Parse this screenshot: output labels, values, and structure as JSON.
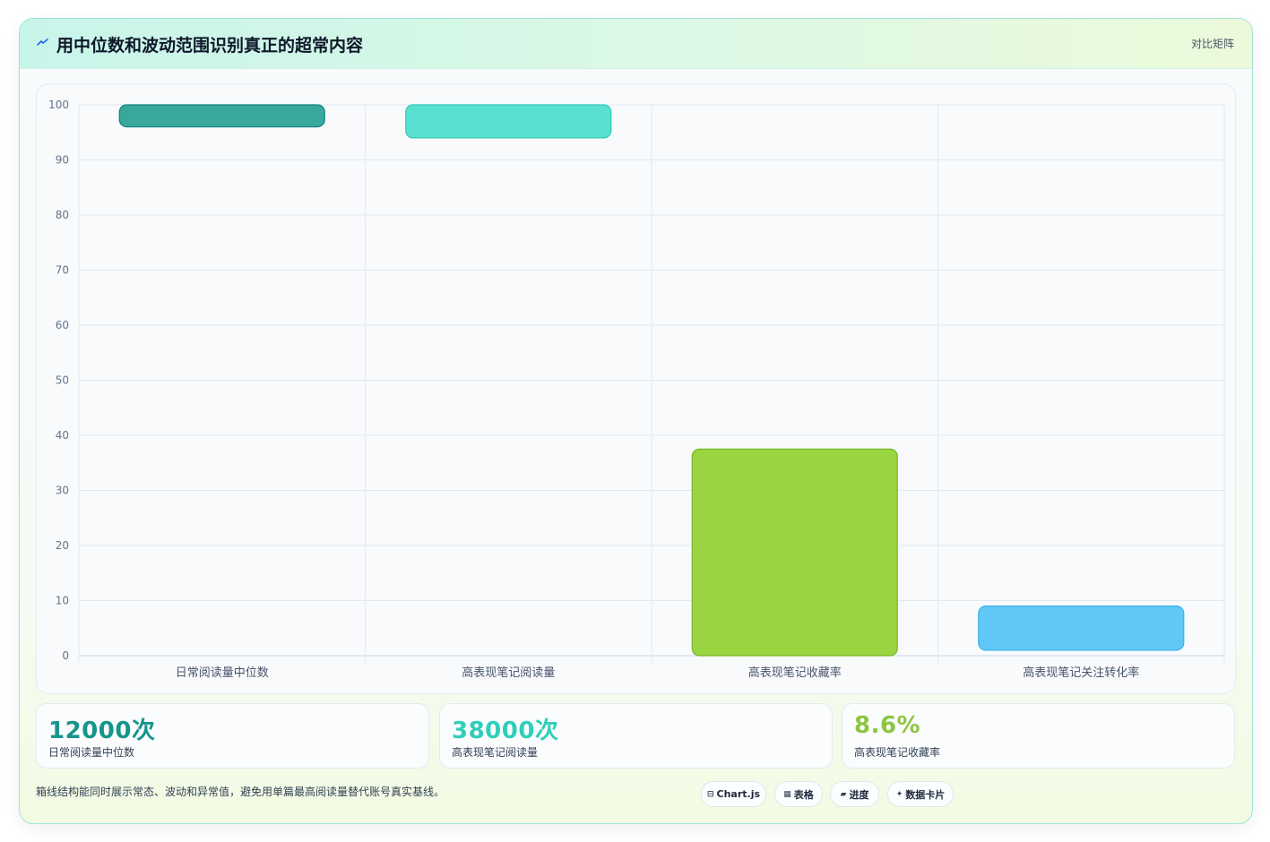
{
  "header": {
    "title": "用中位数和波动范围识别真正的超常内容",
    "tag": "对比矩阵"
  },
  "chart_data": {
    "type": "bar",
    "categories": [
      "日常阅读量中位数",
      "高表现笔记阅读量",
      "高表现笔记收藏率",
      "高表现笔记关注转化率"
    ],
    "ranges": [
      [
        96,
        100
      ],
      [
        94,
        100
      ],
      [
        0,
        37.5
      ],
      [
        1,
        9
      ]
    ],
    "ylim": [
      0,
      100
    ],
    "yticks": [
      0,
      10,
      20,
      30,
      40,
      50,
      60,
      70,
      80,
      90,
      100
    ],
    "grid": true,
    "colors": [
      "#38a89d",
      "#5ae0d0",
      "#9ad440",
      "#60c8f7"
    ],
    "edge_colors": [
      "#16857a",
      "#2fc9b5",
      "#7ab82a",
      "#38b0ee"
    ],
    "title": "",
    "xlabel": "",
    "ylabel": ""
  },
  "kpis": [
    {
      "value": "12000次",
      "label": "日常阅读量中位数",
      "color": "#16958a"
    },
    {
      "value": "38000次",
      "label": "高表现笔记阅读量",
      "color": "#2ecfb8"
    },
    {
      "value": "8.6%",
      "label": "高表现笔记收藏率",
      "color": "#8cc63f"
    }
  ],
  "footer": {
    "note": "箱线结构能同时展示常态、波动和异常值，避免用单篇最高阅读量替代账号真实基线。",
    "chips": [
      {
        "icon": "⊟",
        "icon_name": "chart-icon",
        "label": "Chart.js"
      },
      {
        "icon": "▦",
        "icon_name": "table-icon",
        "label": "表格"
      },
      {
        "icon": "▰",
        "icon_name": "progress-icon",
        "label": "进度"
      },
      {
        "icon": "✦",
        "icon_name": "card-icon",
        "label": "数据卡片"
      }
    ]
  }
}
